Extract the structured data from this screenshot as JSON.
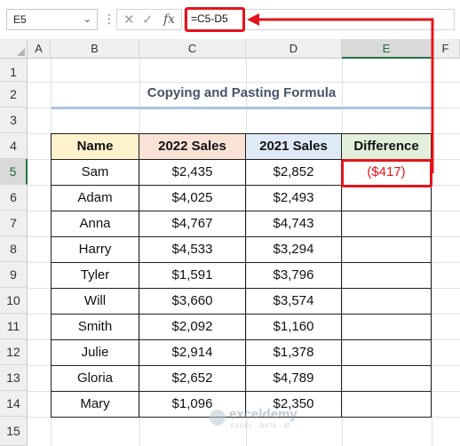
{
  "formula_bar": {
    "name_box": "E5",
    "formula": "=C5-D5"
  },
  "columns": [
    "A",
    "B",
    "C",
    "D",
    "E",
    "F"
  ],
  "rows": [
    "1",
    "2",
    "3",
    "4",
    "5",
    "6",
    "7",
    "8",
    "9",
    "10",
    "11",
    "12",
    "13",
    "14",
    "15"
  ],
  "sheet": {
    "title": "Copying and Pasting Formula",
    "headers": [
      "Name",
      "2022 Sales",
      "2021 Sales",
      "Difference"
    ],
    "data": [
      {
        "name": "Sam",
        "s2022": "$2,435",
        "s2021": "$2,852",
        "diff": "($417)"
      },
      {
        "name": "Adam",
        "s2022": "$4,025",
        "s2021": "$2,493",
        "diff": ""
      },
      {
        "name": "Anna",
        "s2022": "$4,767",
        "s2021": "$4,743",
        "diff": ""
      },
      {
        "name": "Harry",
        "s2022": "$4,533",
        "s2021": "$3,294",
        "diff": ""
      },
      {
        "name": "Tyler",
        "s2022": "$1,591",
        "s2021": "$3,796",
        "diff": ""
      },
      {
        "name": "Will",
        "s2022": "$3,660",
        "s2021": "$3,574",
        "diff": ""
      },
      {
        "name": "Smith",
        "s2022": "$2,092",
        "s2021": "$1,160",
        "diff": ""
      },
      {
        "name": "Julie",
        "s2022": "$2,914",
        "s2021": "$1,378",
        "diff": ""
      },
      {
        "name": "Gloria",
        "s2022": "$2,652",
        "s2021": "$4,789",
        "diff": ""
      },
      {
        "name": "Mary",
        "s2022": "$1,096",
        "s2021": "$2,350",
        "diff": ""
      }
    ]
  },
  "header_colors": {
    "name": "#fdf2cc",
    "s2022": "#fbe2d6",
    "s2021": "#deeaf6",
    "diff": "#e2efda"
  },
  "accent": "#e3141b",
  "watermark": {
    "name": "exceldemy",
    "tagline": "EXCEL · DATA · BI"
  }
}
